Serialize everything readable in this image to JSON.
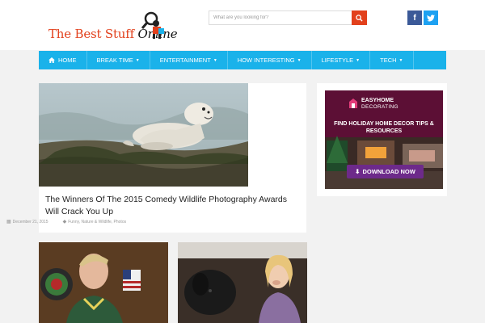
{
  "header": {
    "logo": {
      "text_main": "The Best Stuff ",
      "text_italic": "Online"
    },
    "search": {
      "placeholder": "What are you looking for?"
    },
    "social": {
      "facebook": "f",
      "twitter": "t"
    }
  },
  "nav": {
    "items": [
      {
        "label": "HOME",
        "icon": "home-icon"
      },
      {
        "label": "BREAK TIME",
        "has_dropdown": true
      },
      {
        "label": "ENTERTAINMENT",
        "has_dropdown": true
      },
      {
        "label": "HOW INTERESTING",
        "has_dropdown": true
      },
      {
        "label": "LIFESTYLE",
        "has_dropdown": true
      },
      {
        "label": "TECH",
        "has_dropdown": true
      }
    ]
  },
  "featured": {
    "title": "The Winners Of The 2015 Comedy Wildlife Photography Awards Will Crack You Up",
    "date": "December 21, 2015",
    "categories": "Funny, Nature & Wildlife, Photos"
  },
  "ad": {
    "brand_line1": "EASYHOME",
    "brand_line2": "DECORATING",
    "headline": "FIND HOLIDAY HOME DECOR TIPS & RESOURCES",
    "cta": "DOWNLOAD NOW"
  },
  "colors": {
    "accent": "#e2401c",
    "nav": "#1ab2ea",
    "facebook": "#3b5998",
    "twitter": "#1da1f2",
    "ad_cta": "#6d2a8a"
  }
}
